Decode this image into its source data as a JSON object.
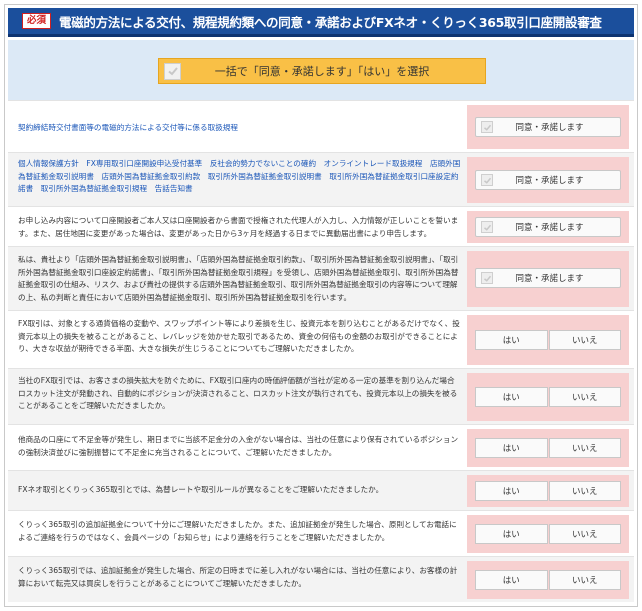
{
  "header": {
    "badge": "必須",
    "title": "電磁的方法による交付、規程規約類への同意・承諾およびFXネオ・くりっく365取引口座開設審査"
  },
  "bulk": {
    "label": "一括で「同意・承諾します」「はい」を選択"
  },
  "rows": [
    {
      "text": "契約締結時交付書面等の電磁的方法による交付等に係る取扱規程",
      "link": true,
      "type": "agree",
      "button": "同意・承諾します"
    },
    {
      "text": "個人情報保護方針　FX専用取引口座開設申込受付基準　反社会的勢力でないことの確約　オンライントレード取扱規程　店頭外国為替証拠金取引説明書　店頭外国為替証拠金取引約款　取引所外国為替証拠金取引説明書　取引所外国為替証拠金取引口座設定約諾書　取引所外国為替証拠金取引規程　告話告知書",
      "link": true,
      "type": "agree",
      "button": "同意・承諾します"
    },
    {
      "text": "お申し込み内容について口座開設者ご本人又は口座開設者から書面で授権された代理人が入力し、入力情報が正しいことを誓います。また、居住地国に変更があった場合は、変更があった日から3ヶ月を経過する日までに異動届出書により申告します。",
      "link": false,
      "type": "agree",
      "button": "同意・承諾します"
    },
    {
      "text": "私は、貴社より「店頭外国為替証拠金取引説明書」、「店頭外国為替証拠金取引約款」、「取引所外国為替証拠金取引説明書」、「取引所外国為替証拠金取引口座設定約諾書」、「取引所外国為替証拠金取引規程」を受領し、店頭外国為替証拠金取引、取引所外国為替証拠金取引の仕組み、リスク、および貴社の提供する店頭外国為替証拠金取引、取引所外国為替証拠金取引の内容等について理解の上、私の判断と責任において店頭外国為替証拠金取引、取引所外国為替証拠金取引を行います。",
      "link": false,
      "type": "agree",
      "button": "同意・承諾します"
    },
    {
      "text": "FX取引は、対象とする通貨価格の変動や、スワップポイント等により差損を生じ、投資元本を割り込むことがあるだけでなく、投資元本以上の損失を被ることがあること、レバレッジを効かせた取引であるため、資金の何倍もの金額のお取引ができることにより、大きな収益が期待できる半面、大きな損失が生じうることについてもご理解いただきましたか。",
      "link": false,
      "type": "yesno",
      "yes": "はい",
      "no": "いいえ"
    },
    {
      "text": "当社のFX取引では、お客さまの損失拡大を防ぐために、FX取引口座内の時価評価額が当社が定める一定の基準を割り込んだ場合ロスカット注文が発動され、自動的にポジションが決済されること、ロスカット注文が執行されても、投資元本以上の損失を被ることがあることをご理解いただきましたか。",
      "link": false,
      "type": "yesno",
      "yes": "はい",
      "no": "いいえ"
    },
    {
      "text": "他商品の口座にて不足金等が発生し、期日までに当該不足金分の入金がない場合は、当社の任意により保有されているポジションの強制決済並びに強制振替にて不足金に充当されることについて、ご理解いただきましたか。",
      "link": false,
      "type": "yesno",
      "yes": "はい",
      "no": "いいえ"
    },
    {
      "text": "FXネオ取引とくりっく365取引とでは、為替レートや取引ルールが異なることをご理解いただきましたか。",
      "link": false,
      "type": "yesno",
      "yes": "はい",
      "no": "いいえ"
    },
    {
      "text": "くりっく365取引の追加証拠金について十分にご理解いただきましたか。また、追加証拠金が発生した場合、原則としてお電話によるご連絡を行うのではなく、会員ページの「お知らせ」により連絡を行うことをご理解いただきましたか。",
      "link": false,
      "type": "yesno",
      "yes": "はい",
      "no": "いいえ"
    },
    {
      "text": "くりっく365取引では、追加証拠金が発生した場合、所定の日時までに差し入れがない場合には、当社の任意により、お客様の計算において転売又は買戻しを行うことがあることについてご理解いただきましたか。",
      "link": false,
      "type": "yesno",
      "yes": "はい",
      "no": "いいえ"
    }
  ]
}
